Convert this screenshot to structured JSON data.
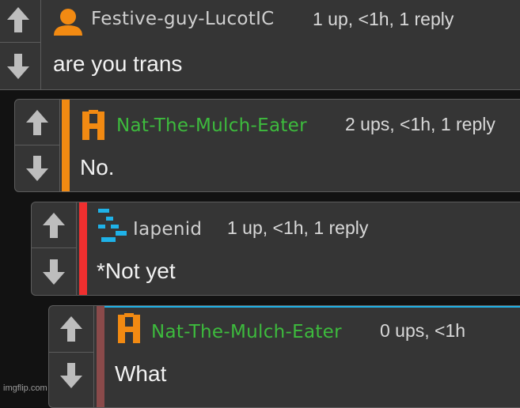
{
  "colors": {
    "background": "#121212",
    "panel": "#353535",
    "border": "#5c5c5c",
    "arrow": "#bdbdbd",
    "accent_orange": "#f28a12",
    "accent_red": "#f02f2f",
    "accent_brown": "#8a4a4a",
    "accent_blue": "#1fb2e8",
    "username_gray": "#cfcfcf",
    "username_green": "#3dbb3d"
  },
  "comments": [
    {
      "username": "Festive-guy-LucotIC",
      "avatar_icon": "person-icon",
      "meta": "1 up, <1h, 1 reply",
      "text": "are you trans"
    },
    {
      "username": "Nat-The-Mulch-Eater",
      "avatar_icon": "h-logo-icon",
      "meta": "2 ups, <1h, 1 reply",
      "text": "No."
    },
    {
      "username": "Iapenid",
      "avatar_icon": "pixel-pattern-icon",
      "meta": "1 up, <1h, 1 reply",
      "text": "*Not yet"
    },
    {
      "username": "Nat-The-Mulch-Eater",
      "avatar_icon": "h-logo-icon",
      "meta": "0 ups, <1h",
      "text": "What"
    }
  ],
  "watermark": "imgflip.com"
}
